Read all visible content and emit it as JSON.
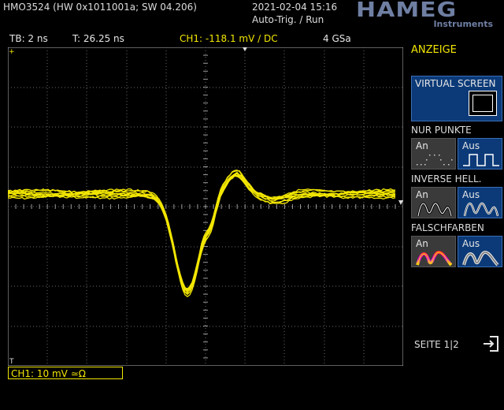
{
  "header": {
    "device": "HMO3524 (HW 0x1011001a; SW 04.206)",
    "datetime": "2021-02-04 15:16",
    "trigger_mode": "Auto-Trig. / Run",
    "logo_text": "HAMEG",
    "logo_sub": "Instruments"
  },
  "status": {
    "timebase": "TB: 2 ns",
    "trigger_pos": "T: 26.25 ns",
    "ch1_trigger": "CH1: -118.1 mV ∕ DC",
    "sample_rate": "4 GSa"
  },
  "channel": {
    "label": "CH1: 10 mV ≃Ω",
    "marker": "1",
    "color": "#f2e600"
  },
  "menu": {
    "title": "ANZEIGE",
    "virtual_screen": "VIRTUAL SCREEN",
    "nur_punkte": {
      "label": "NUR PUNKTE",
      "an": "An",
      "aus": "Aus",
      "selected": "Aus"
    },
    "inverse_hell": {
      "label": "INVERSE HELL.",
      "an": "An",
      "aus": "Aus",
      "selected": "An"
    },
    "falschfarben": {
      "label": "FALSCHFARBEN",
      "an": "An",
      "aus": "Aus",
      "selected": "Aus"
    },
    "page": "SEITE 1|2"
  },
  "icons": {
    "exit": "exit-icon",
    "virtual_screen": "virtual-screen-icon"
  }
}
